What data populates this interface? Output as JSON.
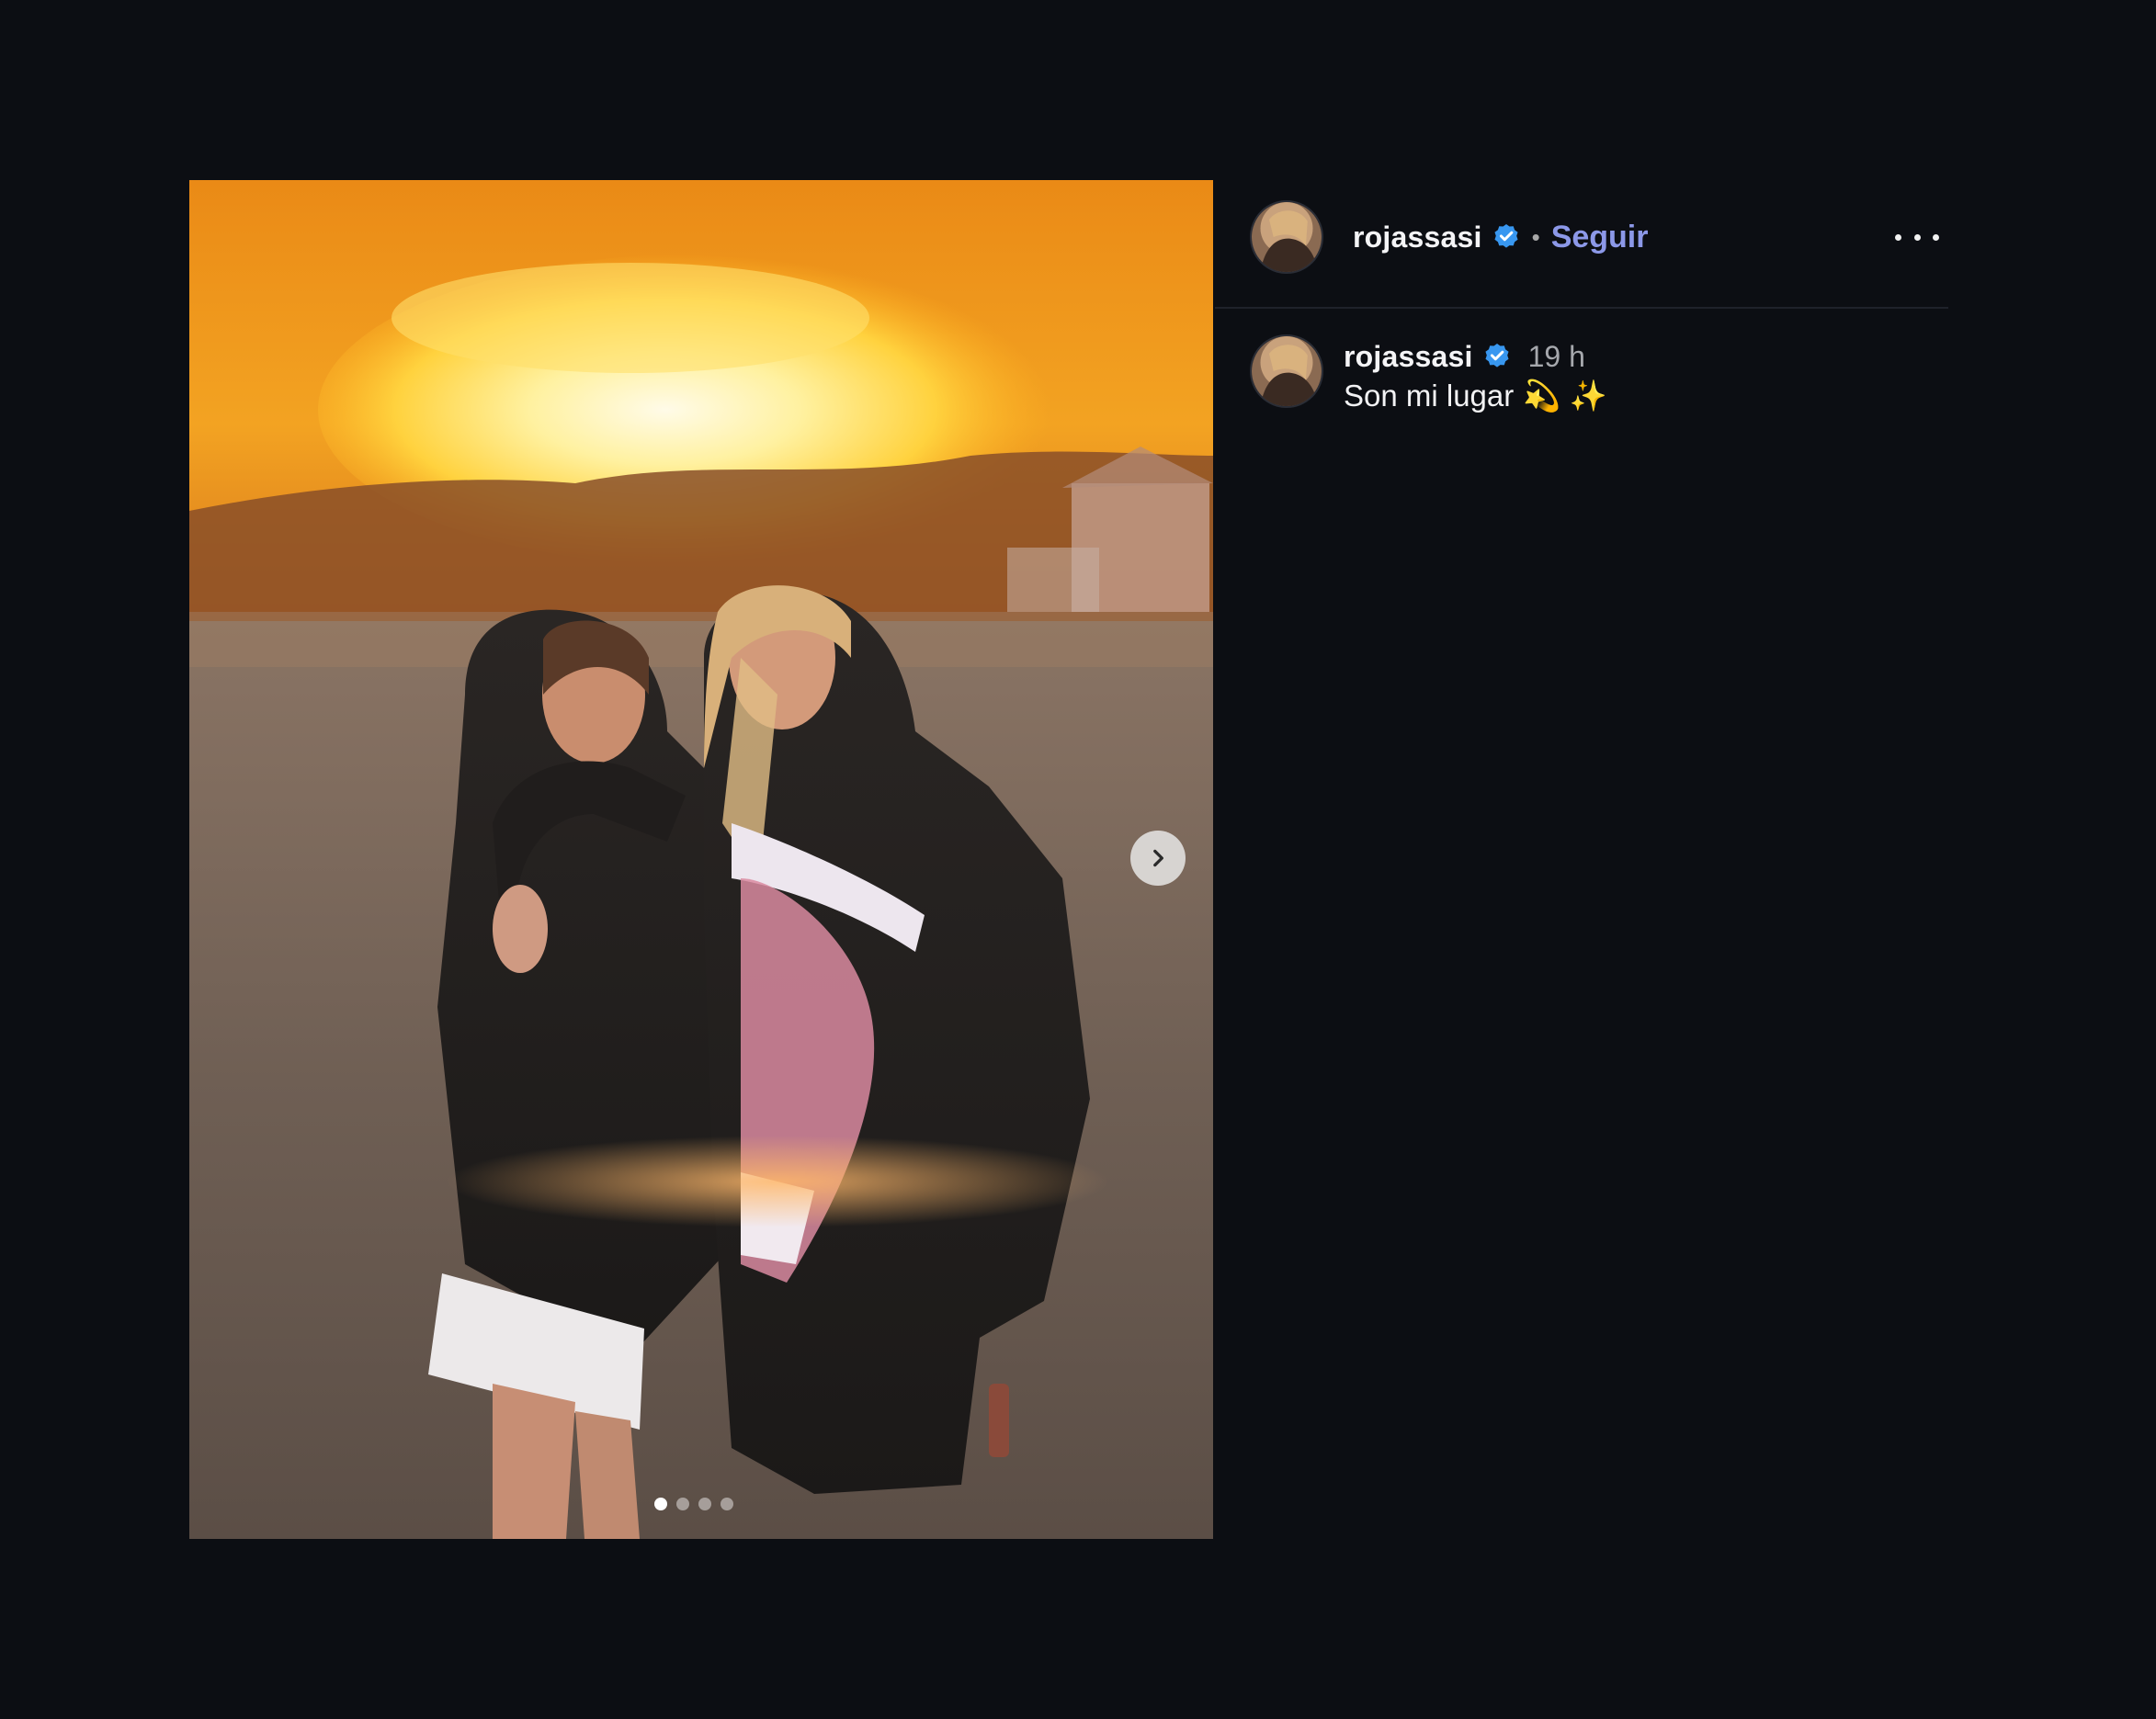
{
  "post": {
    "image_alt": "",
    "carousel": {
      "slide_count": 4,
      "active_slide": 1
    }
  },
  "author": {
    "username": "rojassasi",
    "verified": true,
    "separator": "•",
    "follow_label": "Seguir"
  },
  "caption": {
    "username": "rojassasi",
    "timestamp": "19 h",
    "text": "Son mi lugar",
    "emojis": "💫 ✨"
  },
  "icons": {
    "next": "chevron-right-icon",
    "more": "more-horizontal-icon",
    "verified": "verified-badge-icon"
  },
  "colors": {
    "background": "#0c0e13",
    "follow": "#8c98e8",
    "verified": "#3897f0"
  }
}
